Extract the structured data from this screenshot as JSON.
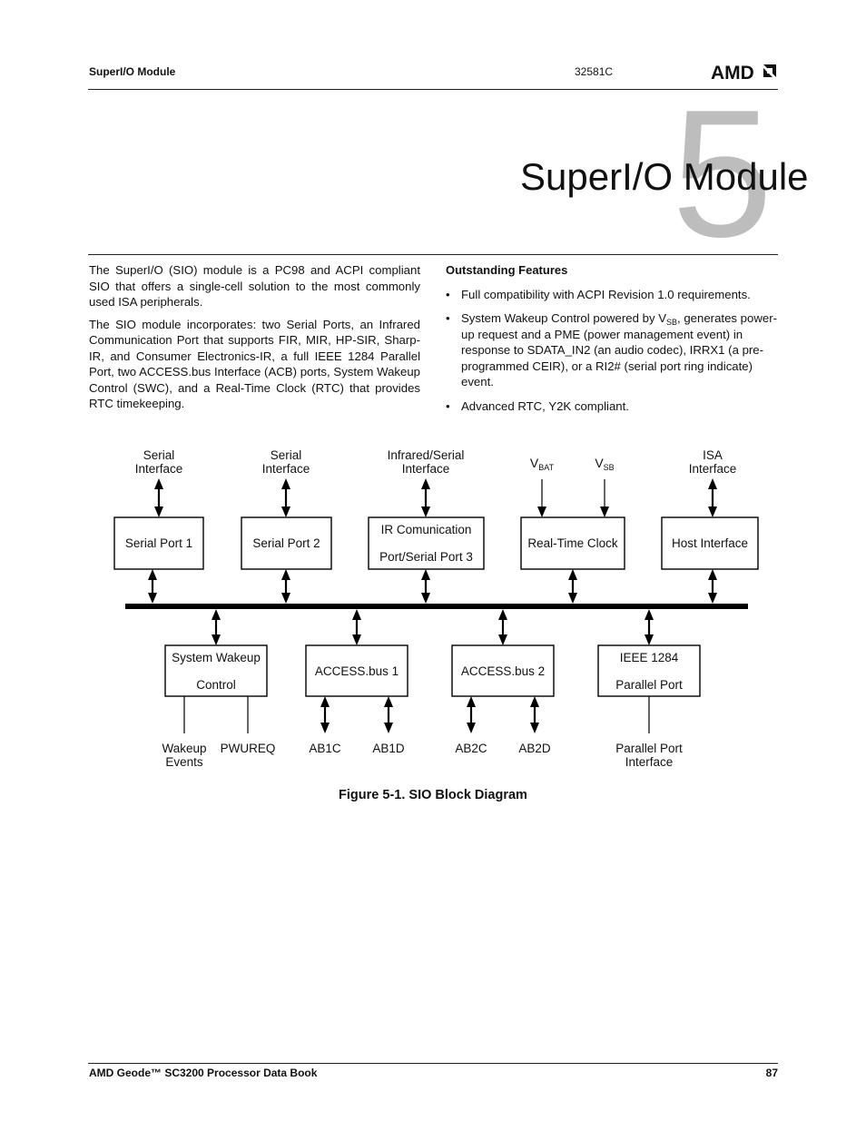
{
  "header": {
    "section": "SuperI/O Module",
    "doc_number": "32581C",
    "logo_text": "AMD"
  },
  "chapter": {
    "number": "5",
    "title": "SuperI/O Module"
  },
  "intro": {
    "paragraphs": [
      "The SuperI/O (SIO) module is a PC98 and ACPI compliant SIO that offers a single-cell solution to the most commonly used ISA peripherals.",
      "The SIO module incorporates: two Serial Ports, an Infrared Communication Port that supports FIR, MIR, HP-SIR, Sharp-IR, and Consumer Electronics-IR, a full IEEE 1284 Parallel Port, two ACCESS.bus Interface (ACB) ports, System Wakeup Control (SWC), and a Real-Time Clock (RTC) that provides RTC timekeeping."
    ]
  },
  "features": {
    "heading": "Outstanding Features",
    "bullet": "•",
    "items": [
      {
        "text": "Full compatibility with ACPI Revision 1.0 requirements."
      },
      {
        "pre": "System Wakeup Control powered by V",
        "sub": "SB",
        "post": ", generates power-up request and a PME (power management event) in response to SDATA_IN2 (an audio codec), IRRX1 (a pre-programmed CEIR), or a RI2# (serial port ring indicate) event."
      },
      {
        "text": "Advanced RTC, Y2K compliant."
      }
    ]
  },
  "diagram": {
    "top_blocks": [
      {
        "id": "serial-port-1",
        "label": [
          "Serial Port 1"
        ],
        "ext_label": [
          "Serial",
          "Interface"
        ],
        "ext_type": "bidir"
      },
      {
        "id": "serial-port-2",
        "label": [
          "Serial Port 2"
        ],
        "ext_label": [
          "Serial",
          "Interface"
        ],
        "ext_type": "bidir"
      },
      {
        "id": "ir-port",
        "label": [
          "IR Comunication",
          "Port/Serial Port 3"
        ],
        "ext_label": [
          "Infrared/Serial",
          "Interface"
        ],
        "ext_type": "bidir"
      },
      {
        "id": "rtc",
        "label": [
          "Real-Time Clock"
        ],
        "inputs": [
          {
            "main": "V",
            "sub": "BAT"
          },
          {
            "main": "V",
            "sub": "SB"
          }
        ]
      },
      {
        "id": "host-interface",
        "label": [
          "Host Interface"
        ],
        "ext_label": [
          "ISA",
          "Interface"
        ],
        "ext_type": "bidir"
      }
    ],
    "bottom_blocks": [
      {
        "id": "system-wakeup-control",
        "label": [
          "System Wakeup",
          "Control"
        ],
        "signals": [
          {
            "label": [
              "Wakeup",
              "Events"
            ],
            "dir": "out"
          },
          {
            "label": [
              "PWUREQ"
            ],
            "dir": "in"
          }
        ]
      },
      {
        "id": "access-bus-1",
        "label": [
          "ACCESS.bus 1"
        ],
        "signals": [
          {
            "label": [
              "AB1C"
            ],
            "dir": "bidir"
          },
          {
            "label": [
              "AB1D"
            ],
            "dir": "bidir"
          }
        ]
      },
      {
        "id": "access-bus-2",
        "label": [
          "ACCESS.bus 2"
        ],
        "signals": [
          {
            "label": [
              "AB2C"
            ],
            "dir": "bidir"
          },
          {
            "label": [
              "AB2D"
            ],
            "dir": "bidir"
          }
        ]
      },
      {
        "id": "parallel-port",
        "label": [
          "IEEE 1284",
          "Parallel Port"
        ],
        "signals": [
          {
            "label": [
              "Parallel Port",
              "Interface"
            ],
            "dir": "out"
          }
        ]
      }
    ],
    "caption": "Figure 5-1.  SIO Block Diagram"
  },
  "footer": {
    "book_title": "AMD Geode™ SC3200 Processor Data Book",
    "page_number": "87"
  }
}
